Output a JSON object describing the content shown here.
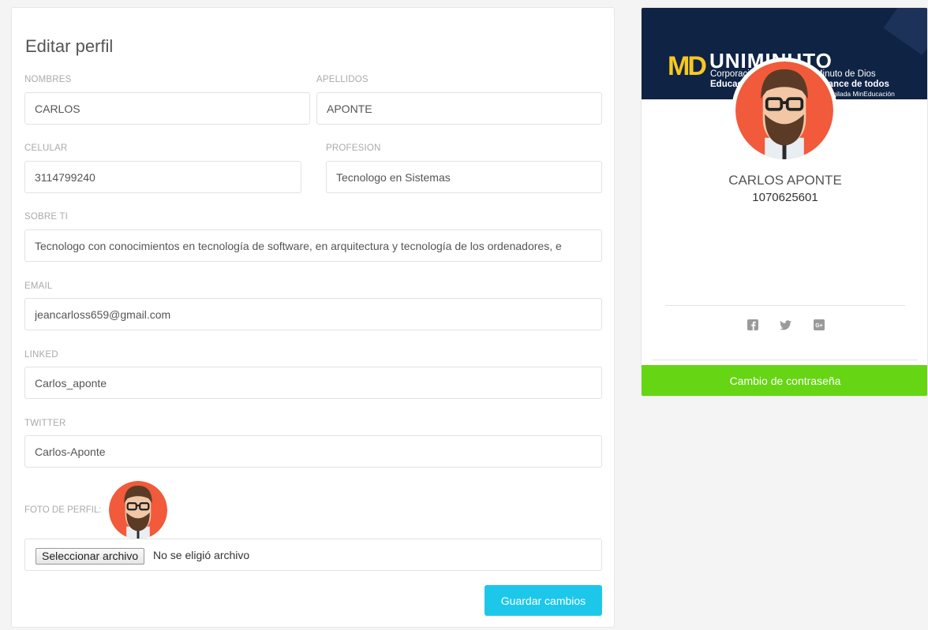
{
  "edit_profile": {
    "title": "Editar perfil",
    "fields": {
      "nombres": {
        "label": "NOMBRES",
        "value": "CARLOS"
      },
      "apellidos": {
        "label": "APELLIDOS",
        "value": "APONTE"
      },
      "celular": {
        "label": "CELULAR",
        "value": "3114799240"
      },
      "profesion": {
        "label": "PROFESION",
        "value": "Tecnologo en Sistemas"
      },
      "sobre_ti": {
        "label": "SOBRE TI",
        "value": "Tecnologo con conocimientos en tecnología de software, en arquitectura y tecnología de los ordenadores, e"
      },
      "email": {
        "label": "EMAIL",
        "value": "jeancarloss659@gmail.com"
      },
      "linked": {
        "label": "LINKED",
        "value": "Carlos_aponte"
      },
      "twitter": {
        "label": "TWITTER",
        "value": "Carlos-Aponte"
      }
    },
    "photo_label": "FOTO DE PERFIL:",
    "file_button": "Seleccionar archivo",
    "file_status": "No se eligió archivo",
    "save_button": "Guardar cambios"
  },
  "user_card": {
    "banner": {
      "logo_mark": "MD",
      "logo_text": "UNIMINUTO",
      "line1": "Corporación Universitaria Minuto de Dios",
      "line2": "Educación de calidad al alcance de todos",
      "line3": "Vigilada MinEducación"
    },
    "name": "CARLOS APONTE",
    "id_number": "1070625601",
    "social_icons": [
      "facebook-icon",
      "twitter-icon",
      "google-plus-icon"
    ],
    "password_button": "Cambio de contraseña"
  },
  "colors": {
    "save_button": "#1dc7ea",
    "password_button": "#66d513",
    "banner": "#0f2345",
    "avatar_bg": "#f15a3b"
  }
}
